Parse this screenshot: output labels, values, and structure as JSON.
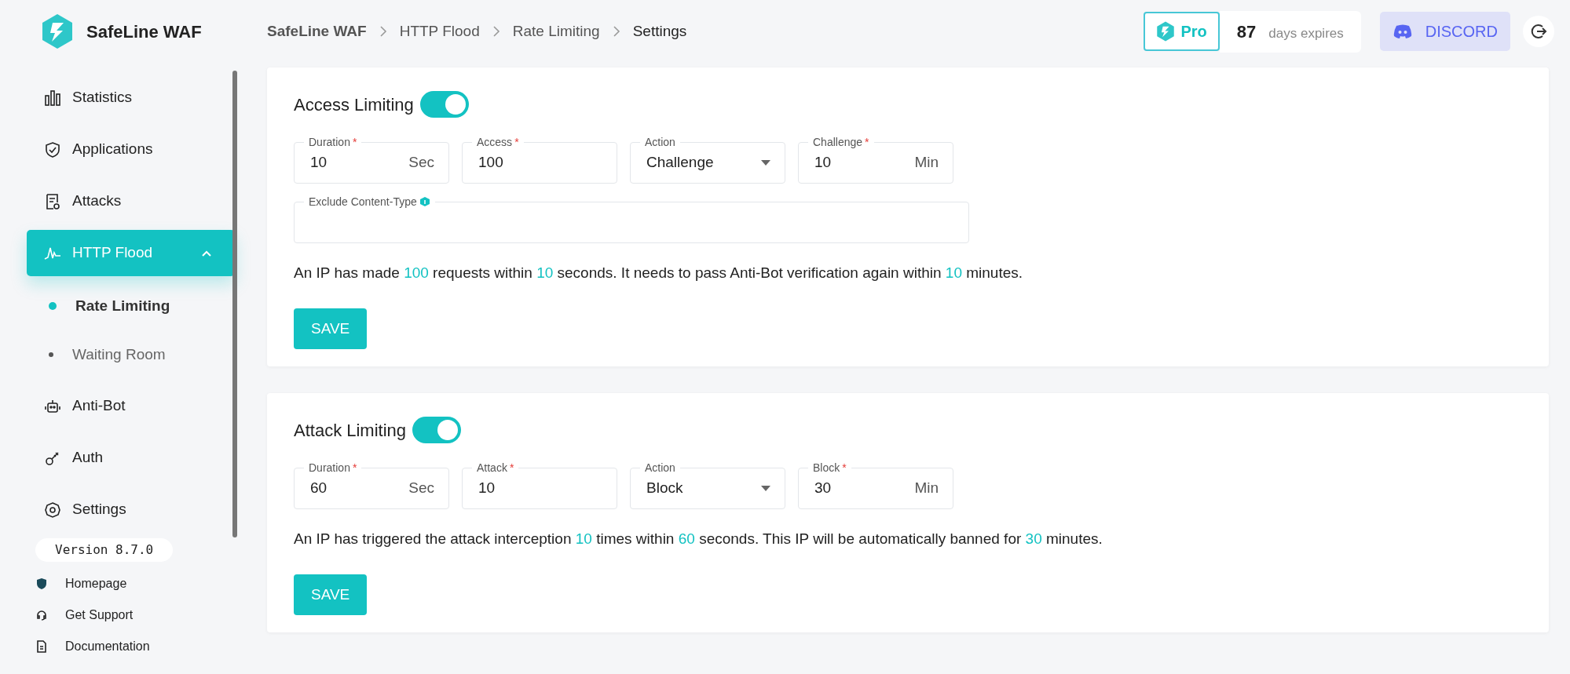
{
  "brand": {
    "name": "SafeLine WAF"
  },
  "breadcrumb": [
    {
      "label": "SafeLine WAF"
    },
    {
      "label": "HTTP Flood"
    },
    {
      "label": "Rate Limiting"
    },
    {
      "label": "Settings"
    }
  ],
  "header": {
    "plan": "Pro",
    "days": "87",
    "days_label": "days expires",
    "discord": "DISCORD"
  },
  "sidebar": {
    "items": [
      {
        "label": "Statistics",
        "selected": false
      },
      {
        "label": "Applications",
        "selected": false
      },
      {
        "label": "Attacks",
        "selected": false
      },
      {
        "label": "HTTP Flood",
        "selected": true,
        "expanded": true,
        "children": [
          {
            "label": "Rate Limiting",
            "selected": true
          },
          {
            "label": "Waiting Room",
            "selected": false
          }
        ]
      },
      {
        "label": "Anti-Bot",
        "selected": false
      },
      {
        "label": "Auth",
        "selected": false
      },
      {
        "label": "Settings",
        "selected": false
      }
    ],
    "version": "Version 8.7.0",
    "links": [
      {
        "label": "Homepage"
      },
      {
        "label": "Get Support"
      },
      {
        "label": "Documentation"
      }
    ]
  },
  "sections": [
    {
      "title": "Access Limiting",
      "on": true,
      "fields": [
        {
          "kind": "input",
          "label": "Duration",
          "required_mark": "*",
          "value": "10",
          "unit": "Sec"
        },
        {
          "kind": "input",
          "label": "Access",
          "required_mark": "*",
          "value": "100"
        },
        {
          "kind": "select",
          "label": "Action",
          "value": "Challenge"
        },
        {
          "kind": "input",
          "label": "Challenge",
          "required_mark": "*",
          "value": "10",
          "unit": "Min"
        }
      ],
      "extra_field": {
        "label": "Exclude Content-Type"
      },
      "summary": [
        {
          "text": "An IP has made ",
          "highlight": false
        },
        {
          "text": "100",
          "highlight": true
        },
        {
          "text": " requests within ",
          "highlight": false
        },
        {
          "text": "10",
          "highlight": true
        },
        {
          "text": " seconds. It needs to pass Anti-Bot verification again within ",
          "highlight": false
        },
        {
          "text": "10",
          "highlight": true
        },
        {
          "text": " minutes.",
          "highlight": false
        }
      ],
      "button": "SAVE"
    },
    {
      "title": "Attack Limiting",
      "on": true,
      "fields": [
        {
          "kind": "input",
          "label": "Duration",
          "required_mark": "*",
          "value": "60",
          "unit": "Sec"
        },
        {
          "kind": "input",
          "label": "Attack",
          "required_mark": "*",
          "value": "10"
        },
        {
          "kind": "select",
          "label": "Action",
          "value": "Block"
        },
        {
          "kind": "input",
          "label": "Block",
          "required_mark": "*",
          "value": "30",
          "unit": "Min"
        }
      ],
      "summary": [
        {
          "text": "An IP has triggered the attack interception ",
          "highlight": false
        },
        {
          "text": "10",
          "highlight": true
        },
        {
          "text": " times within ",
          "highlight": false
        },
        {
          "text": "60",
          "highlight": true
        },
        {
          "text": " seconds. This IP will be automatically banned for ",
          "highlight": false
        },
        {
          "text": "30",
          "highlight": true
        },
        {
          "text": " minutes.",
          "highlight": false
        }
      ],
      "button": "SAVE"
    }
  ]
}
